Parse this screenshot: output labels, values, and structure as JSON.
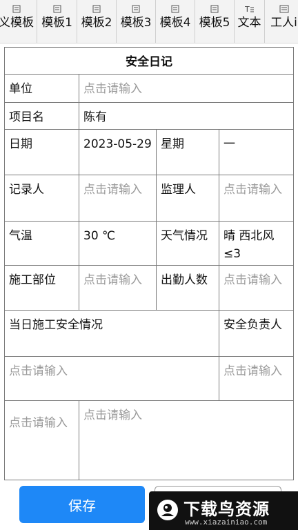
{
  "toolbar": {
    "items": [
      {
        "label": "义模板",
        "icon": "template-icon"
      },
      {
        "label": "模板1",
        "icon": "template-icon"
      },
      {
        "label": "模板2",
        "icon": "template-icon"
      },
      {
        "label": "模板3",
        "icon": "template-icon"
      },
      {
        "label": "模板4",
        "icon": "template-icon"
      },
      {
        "label": "模板5",
        "icon": "template-icon"
      },
      {
        "label": "文本",
        "icon": "text-format-icon"
      },
      {
        "label": "工人i",
        "icon": "keyboard-icon"
      }
    ]
  },
  "form": {
    "title": "安全日记",
    "unit_label": "单位",
    "unit_placeholder": "点击请输入",
    "project_label": "项目名",
    "project_value": "陈有",
    "date_label": "日期",
    "date_value": "2023-05-29",
    "weekday_label": "星期",
    "weekday_value": "一",
    "recorder_label": "记录人",
    "recorder_placeholder": "点击请输入",
    "supervisor_label": "监理人",
    "supervisor_placeholder": "点击请输入",
    "temperature_label": "气温",
    "temperature_value": "30 ℃",
    "weather_label": "天气情况",
    "weather_value": "晴 西北风≤3",
    "position_label": "施工部位",
    "position_placeholder": "点击请输入",
    "attendance_label": "出勤人数",
    "attendance_placeholder": "点击请输入",
    "safety_status_label": "当日施工安全情况",
    "safety_officer_label": "安全负责人",
    "safety_status_placeholder": "点击请输入",
    "safety_officer_placeholder": "点击请输入",
    "extra_left_placeholder": "点击请输入",
    "extra_right_placeholder": "点击请输入"
  },
  "bottom": {
    "save_label": "保存"
  },
  "watermark": {
    "text": "下载鸟资源",
    "url": "www.xiazainiao.com"
  },
  "colors": {
    "accent": "#1e88f7",
    "placeholder": "#9a9a9a",
    "border": "#7a7a7a"
  }
}
